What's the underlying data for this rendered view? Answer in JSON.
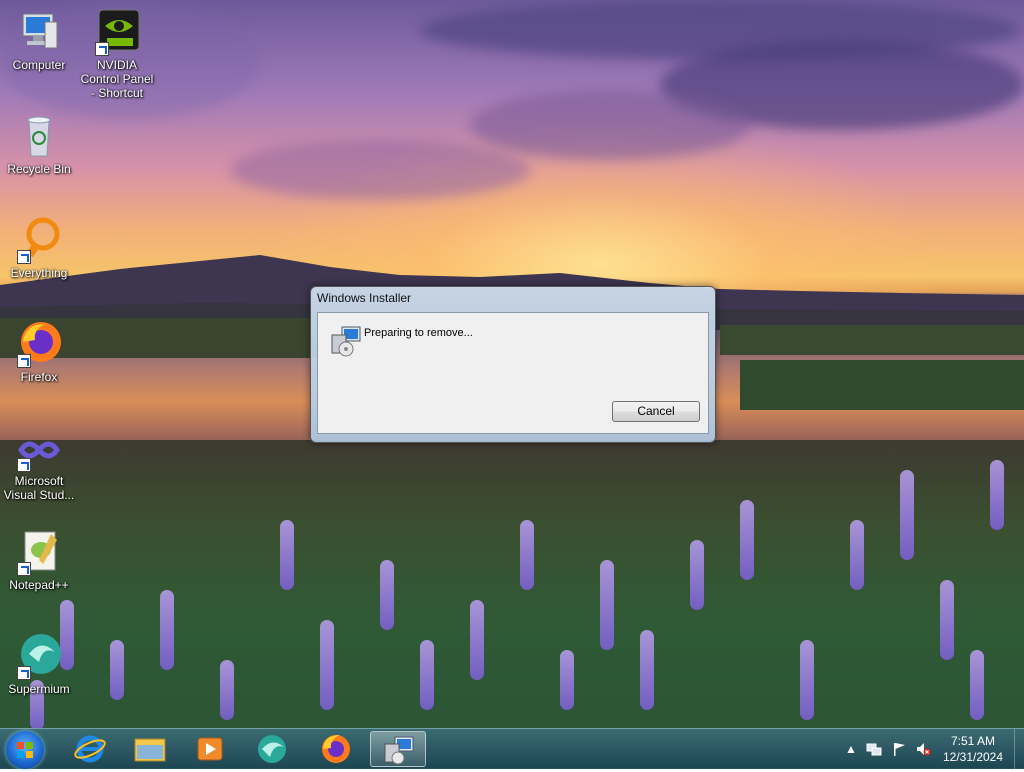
{
  "desktop": {
    "icons": [
      {
        "label": "Computer"
      },
      {
        "label": "NVIDIA Control Panel - Shortcut"
      },
      {
        "label": "Recycle Bin"
      },
      {
        "label": "Everything"
      },
      {
        "label": "Firefox"
      },
      {
        "label": "Microsoft Visual Stud..."
      },
      {
        "label": "Notepad++"
      },
      {
        "label": "Supermium"
      }
    ]
  },
  "dialog": {
    "title": "Windows Installer",
    "message": "Preparing to remove...",
    "cancel_label": "Cancel"
  },
  "taskbar": {
    "pinned": [
      "internet-explorer-icon",
      "file-explorer-icon",
      "media-player-icon",
      "supermium-icon",
      "firefox-icon",
      "windows-installer-icon"
    ],
    "clock": {
      "time": "7:51 AM",
      "date": "12/31/2024"
    }
  }
}
